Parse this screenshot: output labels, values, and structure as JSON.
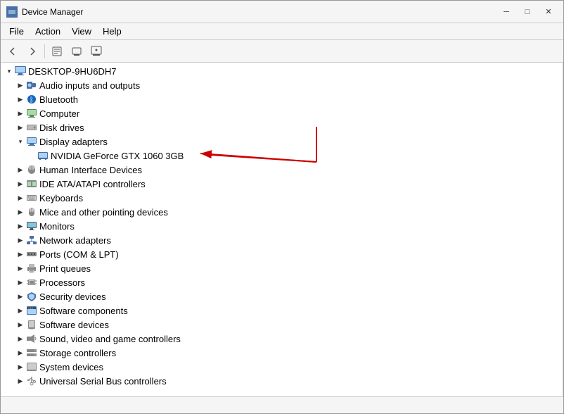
{
  "window": {
    "title": "Device Manager",
    "icon": "⚙"
  },
  "menu": {
    "items": [
      "File",
      "Action",
      "View",
      "Help"
    ]
  },
  "toolbar": {
    "buttons": [
      "←",
      "→",
      "⬛",
      "🔧",
      "🖥"
    ]
  },
  "tree": {
    "root": {
      "label": "DESKTOP-9HU6DH7",
      "expanded": true
    },
    "items": [
      {
        "id": "audio",
        "label": "Audio inputs and outputs",
        "level": 1,
        "expanded": false,
        "icon": "🔊"
      },
      {
        "id": "bluetooth",
        "label": "Bluetooth",
        "level": 1,
        "expanded": false,
        "icon": "🔵"
      },
      {
        "id": "computer",
        "label": "Computer",
        "level": 1,
        "expanded": false,
        "icon": "🖥"
      },
      {
        "id": "disk",
        "label": "Disk drives",
        "level": 1,
        "expanded": false,
        "icon": "💾"
      },
      {
        "id": "display",
        "label": "Display adapters",
        "level": 1,
        "expanded": true,
        "icon": "🖵"
      },
      {
        "id": "gpu",
        "label": "NVIDIA GeForce GTX 1060 3GB",
        "level": 2,
        "expanded": false,
        "icon": "📟",
        "child": true
      },
      {
        "id": "hid",
        "label": "Human Interface Devices",
        "level": 1,
        "expanded": false,
        "icon": "🖱"
      },
      {
        "id": "ide",
        "label": "IDE ATA/ATAPI controllers",
        "level": 1,
        "expanded": false,
        "icon": "💿"
      },
      {
        "id": "keyboards",
        "label": "Keyboards",
        "level": 1,
        "expanded": false,
        "icon": "⌨"
      },
      {
        "id": "mice",
        "label": "Mice and other pointing devices",
        "level": 1,
        "expanded": false,
        "icon": "🖱"
      },
      {
        "id": "monitors",
        "label": "Monitors",
        "level": 1,
        "expanded": false,
        "icon": "🖥"
      },
      {
        "id": "network",
        "label": "Network adapters",
        "level": 1,
        "expanded": false,
        "icon": "🌐"
      },
      {
        "id": "ports",
        "label": "Ports (COM & LPT)",
        "level": 1,
        "expanded": false,
        "icon": "🔌"
      },
      {
        "id": "print",
        "label": "Print queues",
        "level": 1,
        "expanded": false,
        "icon": "🖨"
      },
      {
        "id": "processors",
        "label": "Processors",
        "level": 1,
        "expanded": false,
        "icon": "⚙"
      },
      {
        "id": "security",
        "label": "Security devices",
        "level": 1,
        "expanded": false,
        "icon": "🔒"
      },
      {
        "id": "software-comp",
        "label": "Software components",
        "level": 1,
        "expanded": false,
        "icon": "📦"
      },
      {
        "id": "software-dev",
        "label": "Software devices",
        "level": 1,
        "expanded": false,
        "icon": "📱"
      },
      {
        "id": "sound",
        "label": "Sound, video and game controllers",
        "level": 1,
        "expanded": false,
        "icon": "🎵"
      },
      {
        "id": "storage",
        "label": "Storage controllers",
        "level": 1,
        "expanded": false,
        "icon": "💽"
      },
      {
        "id": "system",
        "label": "System devices",
        "level": 1,
        "expanded": false,
        "icon": "⚙"
      },
      {
        "id": "usb",
        "label": "Universal Serial Bus controllers",
        "level": 1,
        "expanded": false,
        "icon": "🔌"
      }
    ]
  },
  "statusBar": {
    "text": ""
  }
}
